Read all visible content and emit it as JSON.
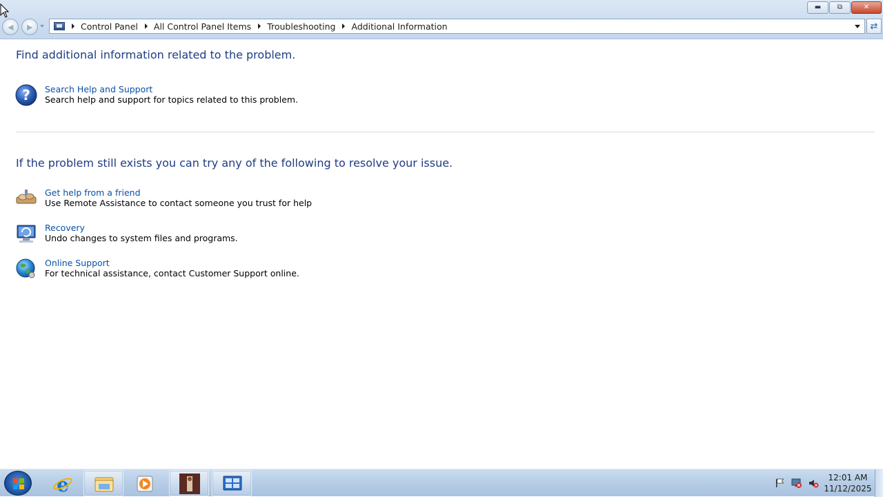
{
  "window": {
    "title_buttons": {
      "minimize_icon": "minimize-icon",
      "maximize_icon": "restore-icon",
      "close_icon": "close-icon"
    }
  },
  "address_bar": {
    "breadcrumbs": [
      "Control Panel",
      "All Control Panel Items",
      "Troubleshooting",
      "Additional Information"
    ]
  },
  "main": {
    "section1": {
      "heading": "Find additional information related to the problem.",
      "tasks": [
        {
          "icon": "help-question-icon",
          "link": "Search Help and Support",
          "description": "Search help and support for topics related to this problem."
        }
      ]
    },
    "section2": {
      "heading": "If the problem still exists you can try any of the following to resolve your issue.",
      "tasks": [
        {
          "icon": "remote-assistance-icon",
          "link": "Get help from a friend",
          "description": "Use Remote Assistance to contact someone you trust for help"
        },
        {
          "icon": "recovery-icon",
          "link": "Recovery",
          "description": "Undo changes to system files and programs."
        },
        {
          "icon": "online-support-globe-icon",
          "link": "Online Support",
          "description": "For technical assistance, contact Customer Support online."
        }
      ]
    }
  },
  "taskbar": {
    "items": [
      "start-orb",
      "internet-explorer-icon",
      "windows-explorer-icon",
      "media-player-icon",
      "app-thumbnail-icon",
      "control-panel-icon"
    ],
    "tray": {
      "icons": [
        "action-center-flag-icon",
        "network-disconnected-icon",
        "volume-muted-icon"
      ],
      "time": "12:01 AM",
      "date": "11/12/2025"
    }
  },
  "colors": {
    "heading": "#1e3c84",
    "link": "#0a4fa6",
    "taskbar": "#b7cde6"
  }
}
